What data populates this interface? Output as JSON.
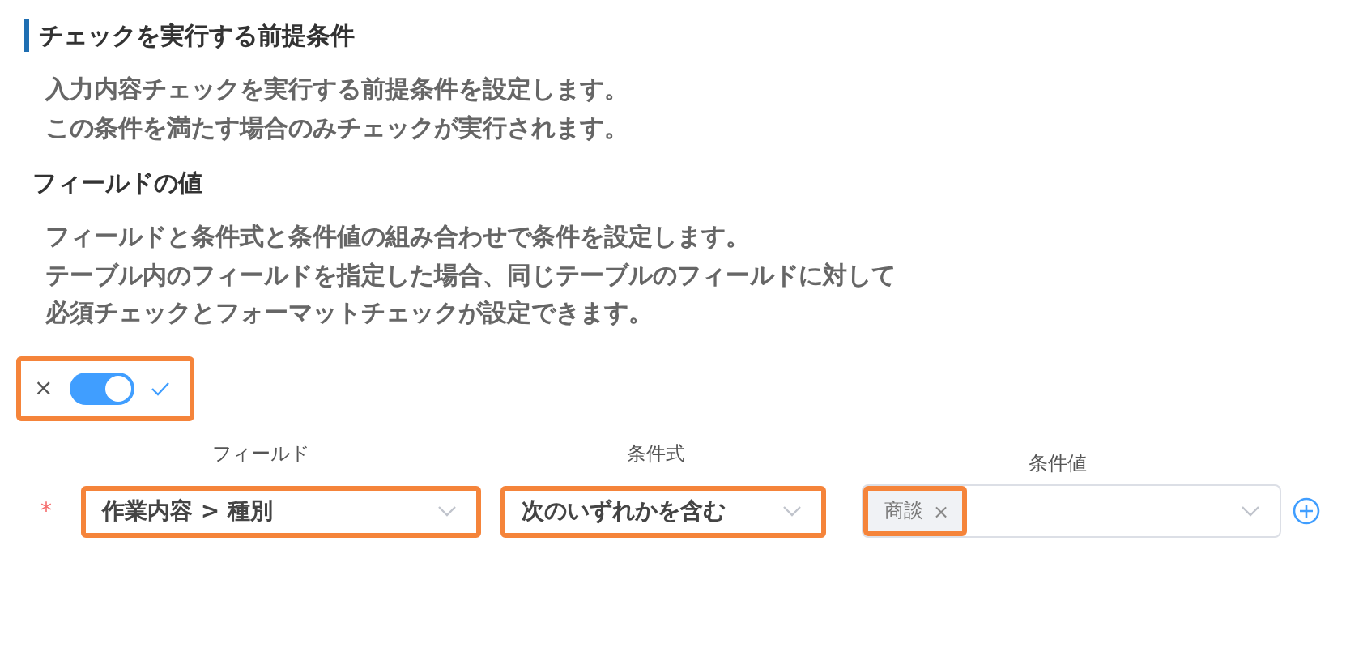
{
  "section_title": "チェックを実行する前提条件",
  "section_description": [
    "入力内容チェックを実行する前提条件を設定します。",
    "この条件を満たす場合のみチェックが実行されます。"
  ],
  "subsection_title": "フィールドの値",
  "subsection_description": [
    "フィールドと条件式と条件値の組み合わせで条件を設定します。",
    "テーブル内のフィールドを指定した場合、同じテーブルのフィールドに対して",
    "必須チェックとフォーマットチェックが設定できます。"
  ],
  "toggle": {
    "on": true,
    "off_symbol": "×",
    "highlighted": true
  },
  "columns": [
    "フィールド",
    "条件式",
    "条件値"
  ],
  "condition": {
    "required_mark": "*",
    "field": {
      "value": "作業内容 > 種別",
      "highlighted": true
    },
    "operator": {
      "value": "次のいずれかを含む",
      "highlighted": true
    },
    "values": [
      {
        "label": "商談",
        "remove_symbol": "×",
        "highlighted": true
      }
    ]
  }
}
